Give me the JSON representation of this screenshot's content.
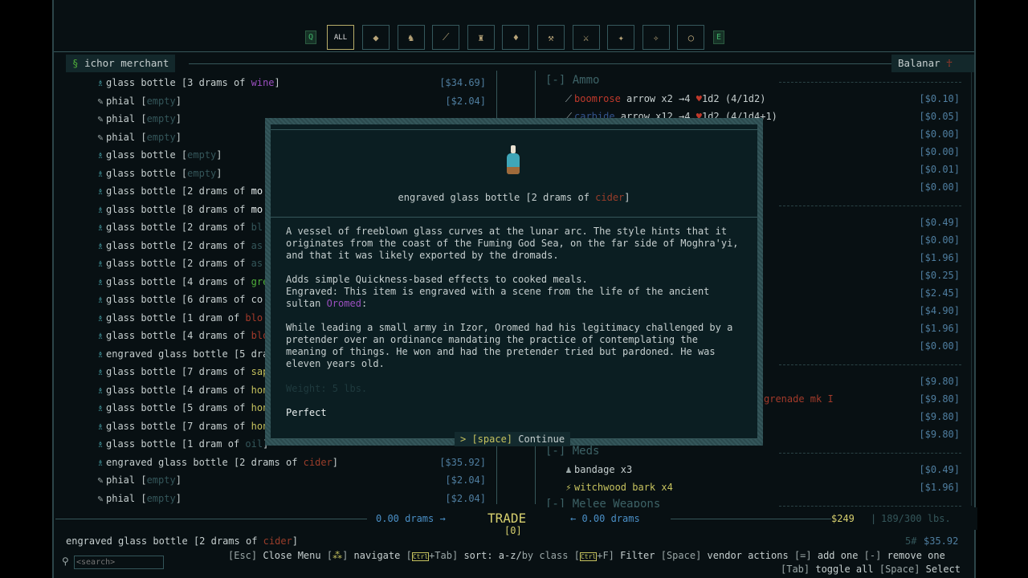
{
  "categories": {
    "prev_key": "Q",
    "next_key": "E",
    "all_label": "ALL",
    "icons": [
      "bullet-icon",
      "creature-icon",
      "arrow-icon",
      "armor-icon",
      "bottle-icon",
      "tool-icon",
      "sword-icon",
      "bone-icon",
      "grenade-icon",
      "ring-icon"
    ]
  },
  "vendor_tab": {
    "name": "ichor merchant"
  },
  "player_tab": {
    "name": "Balanar"
  },
  "left_items": [
    {
      "icon": "bottle",
      "ic": "purple",
      "parts": [
        [
          "glass bottle [3 drams of ",
          ""
        ],
        [
          "wine",
          "purple"
        ],
        [
          "]",
          ""
        ]
      ],
      "price": "[$34.69]"
    },
    {
      "icon": "phial",
      "parts": [
        [
          "phial [",
          ""
        ],
        [
          "empty",
          "dim"
        ],
        [
          "]",
          ""
        ]
      ],
      "price": "[$2.04]"
    },
    {
      "icon": "phial",
      "parts": [
        [
          "phial [",
          ""
        ],
        [
          "empty",
          "dim"
        ],
        [
          "]",
          ""
        ]
      ]
    },
    {
      "icon": "phial",
      "parts": [
        [
          "phial [",
          ""
        ],
        [
          "empty",
          "dim"
        ],
        [
          "]",
          ""
        ]
      ]
    },
    {
      "icon": "bottle",
      "parts": [
        [
          "glass bottle [",
          ""
        ],
        [
          "empty",
          "dim"
        ],
        [
          "]",
          ""
        ]
      ]
    },
    {
      "icon": "bottle",
      "parts": [
        [
          "glass bottle [",
          ""
        ],
        [
          "empty",
          "dim"
        ],
        [
          "]",
          ""
        ]
      ]
    },
    {
      "icon": "bottle",
      "ic": "white",
      "parts": [
        [
          "glass bottle [2 drams of ",
          ""
        ],
        [
          "mo",
          "white"
        ]
      ]
    },
    {
      "icon": "bottle",
      "ic": "white",
      "parts": [
        [
          "glass bottle [8 drams of ",
          ""
        ],
        [
          "mo",
          "white"
        ]
      ]
    },
    {
      "icon": "bottle",
      "parts": [
        [
          "glass bottle [2 drams of ",
          ""
        ],
        [
          "bl",
          "dim"
        ]
      ]
    },
    {
      "icon": "bottle",
      "parts": [
        [
          "glass bottle [2 drams of ",
          ""
        ],
        [
          "as",
          "dim"
        ]
      ]
    },
    {
      "icon": "bottle",
      "parts": [
        [
          "glass bottle [2 drams of ",
          ""
        ],
        [
          "as",
          "dim"
        ]
      ]
    },
    {
      "icon": "bottle",
      "ic": "green",
      "parts": [
        [
          "glass bottle [4 drams of ",
          ""
        ],
        [
          "gre",
          "green"
        ]
      ]
    },
    {
      "icon": "bottle",
      "parts": [
        [
          "glass bottle [6 drams of ",
          ""
        ],
        [
          "co",
          ""
        ]
      ]
    },
    {
      "icon": "bottle",
      "ic": "red",
      "parts": [
        [
          "glass bottle [1 dram of ",
          ""
        ],
        [
          "blo",
          "red"
        ]
      ]
    },
    {
      "icon": "bottle",
      "ic": "red",
      "parts": [
        [
          "glass bottle [4 drams of ",
          ""
        ],
        [
          "blo",
          "red"
        ]
      ]
    },
    {
      "icon": "bottle",
      "ic": "green",
      "parts": [
        [
          "engraved glass bottle [5 dra",
          ""
        ]
      ]
    },
    {
      "icon": "bottle",
      "ic": "yellow",
      "parts": [
        [
          "glass bottle [7 drams of ",
          ""
        ],
        [
          "sap",
          "yellow"
        ]
      ]
    },
    {
      "icon": "bottle",
      "ic": "yellow",
      "parts": [
        [
          "glass bottle [4 drams of ",
          ""
        ],
        [
          "hon",
          "yellow"
        ]
      ]
    },
    {
      "icon": "bottle",
      "ic": "yellow",
      "parts": [
        [
          "glass bottle [5 drams of ",
          ""
        ],
        [
          "hon",
          "yellow"
        ]
      ]
    },
    {
      "icon": "bottle",
      "ic": "yellow",
      "parts": [
        [
          "glass bottle [7 drams of ",
          ""
        ],
        [
          "hon",
          "yellow"
        ]
      ]
    },
    {
      "icon": "bottle",
      "parts": [
        [
          "glass bottle [1 dram of ",
          ""
        ],
        [
          "oil",
          "dim"
        ],
        [
          "]",
          ""
        ]
      ]
    },
    {
      "icon": "bottle",
      "parts": [
        [
          "engraved glass bottle [2 drams of ",
          ""
        ],
        [
          "cider",
          "cider"
        ],
        [
          "]",
          ""
        ]
      ],
      "price": "[$35.92]"
    },
    {
      "icon": "phial",
      "parts": [
        [
          "phial [",
          ""
        ],
        [
          "empty",
          "dim"
        ],
        [
          "]",
          ""
        ]
      ],
      "price": "[$2.04]"
    },
    {
      "icon": "phial",
      "parts": [
        [
          "phial [",
          ""
        ],
        [
          "empty",
          "dim"
        ],
        [
          "]",
          ""
        ]
      ],
      "price": "[$2.04]"
    }
  ],
  "right_rows": [
    {
      "header": "[-] Ammo"
    },
    {
      "icon": "arrow",
      "parts": [
        [
          "boomrose",
          "boom"
        ],
        [
          " arrow x2 →4 ",
          ""
        ],
        [
          "♥",
          "heart"
        ],
        [
          "1d2 (4/1d2)",
          ""
        ]
      ],
      "price": "[$0.10]"
    },
    {
      "icon": "arrow",
      "parts": [
        [
          "carbide",
          "blue"
        ],
        [
          " arrow x12 →4 ",
          ""
        ],
        [
          "♥",
          "heart"
        ],
        [
          "1d2 (4/1d4+1)",
          ""
        ]
      ],
      "price": "[$0.05]"
    },
    {
      "price": "[$0.00]"
    },
    {
      "price": "[$0.00]"
    },
    {
      "price": "[$0.01]"
    },
    {
      "price": "[$0.00]"
    },
    {
      "header": ""
    },
    {
      "price": "[$0.49]"
    },
    {
      "price": "[$0.00]"
    },
    {
      "price": "[$1.96]"
    },
    {
      "price": "[$0.25]"
    },
    {
      "price": "[$2.45]"
    },
    {
      "price": "[$4.90]"
    },
    {
      "price": "[$1.96]"
    },
    {
      "price": "[$0.00]"
    },
    {
      "header": ""
    },
    {
      "price": "[$9.80]"
    },
    {
      "parts": [
        [
          "grenade mk I",
          "red"
        ]
      ],
      "price": "[$9.80]",
      "offset": true
    },
    {
      "price": "[$9.80]"
    },
    {
      "price": "[$9.80]"
    },
    {
      "header": "[-] Meds"
    },
    {
      "icon": "bandage",
      "parts": [
        [
          "bandage x3",
          ""
        ]
      ],
      "price": "[$0.49]"
    },
    {
      "icon": "bark",
      "parts": [
        [
          "witchwood bark x4",
          "yellow"
        ]
      ],
      "price": "[$1.96]"
    },
    {
      "header": "[-] Melee Weapons"
    }
  ],
  "modal": {
    "title_parts": [
      [
        "engraved glass bottle [2 drams of ",
        ""
      ],
      [
        "cider",
        "cider"
      ],
      [
        "]",
        ""
      ]
    ],
    "desc": "A vessel of freeblown glass curves at the lunar arc. The style hints that it\noriginates from the coast of the Fuming God Sea, on the far side of Moghra'yi,\nand that it was likely exported by the dromads.",
    "effect": "Adds simple Quickness-based effects to cooked meals.",
    "engraved": "Engraved: This item is engraved with a scene from the life of the ancient",
    "engraved2": "sultan ",
    "sultan": "Oromed",
    "colon": ":",
    "story": "While leading a small army in Izor, Oromed had his legitimacy challenged by a\npretender over an ordinance mandating the practice of contemplating the\nmeaning of things. He won and had the pretender tried but pardoned. He was\neleven years old.",
    "weight": "Weight: 5 lbs.",
    "condition": "Perfect",
    "continue_prefix": "> ",
    "continue_key": "[space]",
    "continue_label": " Continue"
  },
  "trade": {
    "left_drams": "0.00 drams →",
    "title": "TRADE",
    "count": "[0]",
    "right_drams": "← 0.00 drams",
    "money": "$249",
    "weight": "189/300 lbs."
  },
  "footer": {
    "selected_prefix": "engraved glass bottle [2 drams of ",
    "selected_liquid": "cider",
    "selected_suffix": "]",
    "selected_weight": "5#",
    "selected_price": "$35.92",
    "search_placeholder": "<search>",
    "esc": "[Esc]",
    "close": "Close Menu",
    "nav": "navigate",
    "sort_key": "+Tab]",
    "sort": "sort: a-z/",
    "sort2": "by class",
    "filter_key": "+F]",
    "filter": "Filter",
    "space": "[Space]",
    "vendor_actions": "vendor actions",
    "add_key": "[=]",
    "add": "add one",
    "remove_key": "[-]",
    "remove": "remove one",
    "tab_key": "[Tab]",
    "toggle": "toggle all",
    "space2": "[Space]",
    "select": "Select"
  },
  "colors": {
    "background": "#081013",
    "border": "#36575a",
    "price": "#4f7ea0",
    "trade": "#d6cf6e",
    "drams": "#4a8fc6"
  }
}
